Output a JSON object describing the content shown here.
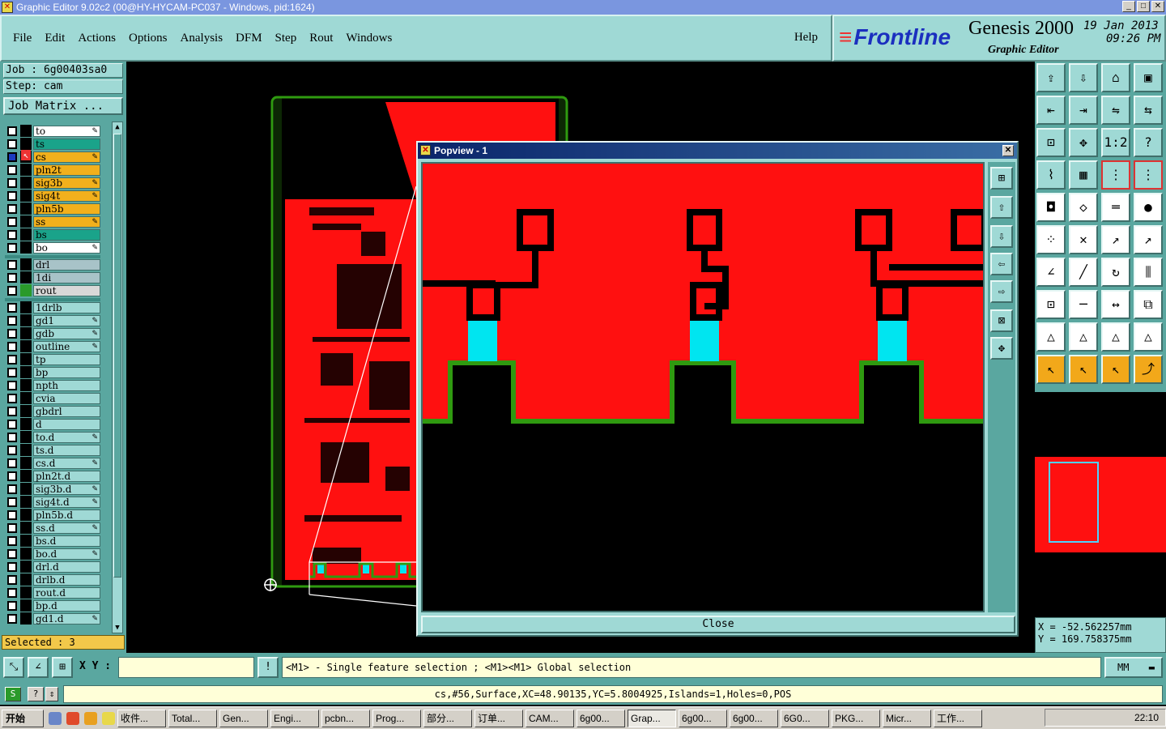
{
  "window": {
    "title": "Graphic Editor 9.02c2 (00@HY-HYCAM-PC037 - Windows, pid:1624)"
  },
  "menu": {
    "items": [
      "File",
      "Edit",
      "Actions",
      "Options",
      "Analysis",
      "DFM",
      "Step",
      "Rout",
      "Windows"
    ],
    "help": "Help"
  },
  "brand": {
    "logo": "Frontline",
    "product": "Genesis 2000",
    "subtitle": "Graphic Editor",
    "date": "19 Jan 2013",
    "time": "09:26 PM"
  },
  "job": {
    "job_line": "Job : 6g00403sa0",
    "step_line": "Step: cam",
    "matrix_button": "Job Matrix ..."
  },
  "layers": [
    {
      "name": "to",
      "color": "#ffffff",
      "pen": true
    },
    {
      "name": "ts",
      "color": "#1aa38a"
    },
    {
      "name": "cs",
      "color": "#f2b01c",
      "active": true,
      "pen": true
    },
    {
      "name": "pln2t",
      "color": "#f2b01c"
    },
    {
      "name": "sig3b",
      "color": "#f2b01c",
      "pen": true
    },
    {
      "name": "sig4t",
      "color": "#f2b01c",
      "pen": true
    },
    {
      "name": "pln5b",
      "color": "#f2b01c"
    },
    {
      "name": "ss",
      "color": "#f2b01c",
      "pen": true
    },
    {
      "name": "bs",
      "color": "#1aa38a"
    },
    {
      "name": "bo",
      "color": "#ffffff",
      "pen": true
    },
    {
      "name": "drl",
      "color": "#a8c3c8"
    },
    {
      "name": "1di",
      "color": "#a8c3c8"
    },
    {
      "name": "rout",
      "color": "#d8d8d8",
      "green": true
    },
    {
      "name": "1drlb",
      "color": "#9fd9d5"
    },
    {
      "name": "gd1",
      "color": "#9fd9d5",
      "pen": true
    },
    {
      "name": "gdb",
      "color": "#9fd9d5",
      "pen": true
    },
    {
      "name": "outline",
      "color": "#9fd9d5",
      "pen": true
    },
    {
      "name": "tp",
      "color": "#9fd9d5"
    },
    {
      "name": "bp",
      "color": "#9fd9d5"
    },
    {
      "name": "npth",
      "color": "#9fd9d5"
    },
    {
      "name": "cvia",
      "color": "#9fd9d5"
    },
    {
      "name": "gbdrl",
      "color": "#9fd9d5"
    },
    {
      "name": "d",
      "color": "#9fd9d5"
    },
    {
      "name": "to.d",
      "color": "#9fd9d5",
      "pen": true
    },
    {
      "name": "ts.d",
      "color": "#9fd9d5"
    },
    {
      "name": "cs.d",
      "color": "#9fd9d5",
      "pen": true
    },
    {
      "name": "pln2t.d",
      "color": "#9fd9d5"
    },
    {
      "name": "sig3b.d",
      "color": "#9fd9d5",
      "pen": true
    },
    {
      "name": "sig4t.d",
      "color": "#9fd9d5",
      "pen": true
    },
    {
      "name": "pln5b.d",
      "color": "#9fd9d5"
    },
    {
      "name": "ss.d",
      "color": "#9fd9d5",
      "pen": true
    },
    {
      "name": "bs.d",
      "color": "#9fd9d5"
    },
    {
      "name": "bo.d",
      "color": "#9fd9d5",
      "pen": true
    },
    {
      "name": "drl.d",
      "color": "#9fd9d5"
    },
    {
      "name": "drlb.d",
      "color": "#9fd9d5"
    },
    {
      "name": "rout.d",
      "color": "#9fd9d5"
    },
    {
      "name": "bp.d",
      "color": "#9fd9d5"
    },
    {
      "name": "gd1.d",
      "color": "#9fd9d5",
      "pen": true
    }
  ],
  "selected_text": "Selected : 3",
  "popview": {
    "title": "Popview - 1",
    "close_label": "Close"
  },
  "coords": {
    "x": "X = -52.562257mm",
    "y": "Y = 169.758375mm"
  },
  "cmd": {
    "xy_label": "X Y :",
    "xy_value": "",
    "message": "<M1> - Single feature selection ; <M1><M1> Global selection",
    "units": "MM"
  },
  "status": {
    "text": "cs,#56,Surface,XC=48.90135,YC=5.8004925,Islands=1,Holes=0,POS"
  },
  "taskbar": {
    "start": "开始",
    "tasks": [
      "收件...",
      "Total...",
      "Gen...",
      "Engi...",
      "pcbn...",
      "Prog...",
      "部分...",
      "订单...",
      "CAM...",
      "6g00...",
      "Grap...",
      "6g00...",
      "6g00...",
      "6G0...",
      "PKG...",
      "Micr...",
      "工作..."
    ],
    "active_index": 10,
    "clock": "22:10"
  },
  "colors": {
    "copper": "#ff1010",
    "pad": "#00e5f0",
    "outline": "#2f9a10",
    "panel": "#9fd9d5",
    "panel_dark": "#5aa7a0"
  }
}
